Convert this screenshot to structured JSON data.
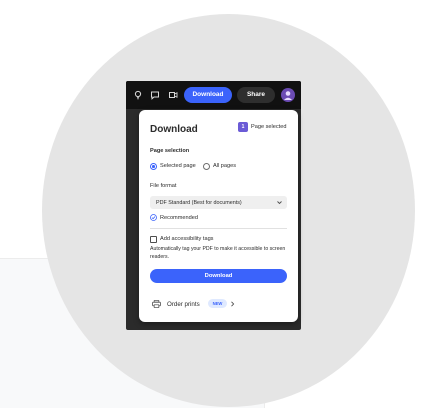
{
  "toolbar": {
    "download_label": "Download",
    "share_label": "Share",
    "icons": [
      "lightbulb-icon",
      "comment-icon",
      "present-icon"
    ]
  },
  "download_panel": {
    "title": "Download",
    "selected_count": "1",
    "selected_label": "Page selected",
    "page_selection": {
      "label": "Page selection",
      "options": [
        "Selected page",
        "All pages"
      ],
      "selected": "Selected page"
    },
    "file_format": {
      "label": "File format",
      "value": "PDF Standard (Best for documents)",
      "recommended_label": "Recommended"
    },
    "accessibility": {
      "checkbox_label": "Add accessibility tags",
      "checked": false,
      "description": "Automatically tag your PDF to make it accessible to screen readers."
    },
    "download_button_label": "Download",
    "order_prints_label": "Order prints",
    "new_badge": "NEW"
  },
  "colors": {
    "accent": "#3b63fb",
    "badge_purple": "#6b5bd6",
    "new_badge_bg": "#dfe9ff"
  }
}
